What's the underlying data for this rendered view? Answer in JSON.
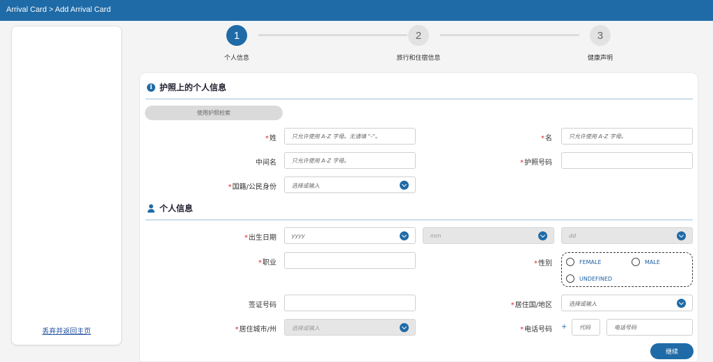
{
  "header": {
    "breadcrumb": "Arrival Card > Add Arrival Card"
  },
  "sidebar": {
    "return_link": "丢弃并返回主页"
  },
  "steps": [
    {
      "number": "1",
      "label": "个人信息",
      "state": "active"
    },
    {
      "number": "2",
      "label": "旅行和住宿信息",
      "state": "inactive"
    },
    {
      "number": "3",
      "label": "健康声明",
      "state": "inactive"
    }
  ],
  "passport_section": {
    "title": "护照上的个人信息",
    "icon": "info-icon",
    "scan_button": "使用护照检索",
    "surname": {
      "label": "姓",
      "placeholder": "只允许使用 A-Z 字母。无请填 \"-\"。"
    },
    "given_name": {
      "label": "名",
      "placeholder": "只允许使用 A-Z 字母。"
    },
    "middle_name": {
      "label": "中间名",
      "placeholder": "只允许使用 A-Z 字母。"
    },
    "passport_no": {
      "label": "护照号码",
      "placeholder": ""
    },
    "nationality": {
      "label": "国籍/公民身份",
      "placeholder": "选择或输入"
    }
  },
  "personal_section": {
    "title": "个人信息",
    "icon": "person-icon",
    "dob": {
      "label": "出生日期",
      "year_placeholder": "yyyy",
      "month_placeholder": "mm",
      "day_placeholder": "dd"
    },
    "occupation": {
      "label": "职业",
      "placeholder": ""
    },
    "gender": {
      "label": "性别",
      "options": [
        "FEMALE",
        "MALE",
        "UNDEFINED"
      ]
    },
    "visa_no": {
      "label": "签证号码",
      "placeholder": ""
    },
    "residence_country": {
      "label": "居住国/地区",
      "placeholder": "选择或输入"
    },
    "residence_city": {
      "label": "居住城市/州",
      "placeholder": "选择或输入"
    },
    "phone": {
      "label": "电话号码",
      "plus": "+",
      "code_placeholder": "代码",
      "number_placeholder": "电话号码"
    }
  },
  "continue_button": "继续",
  "colors": {
    "brand": "#1f6ba7",
    "required": "#d9262c",
    "link": "#1f4e9c"
  }
}
